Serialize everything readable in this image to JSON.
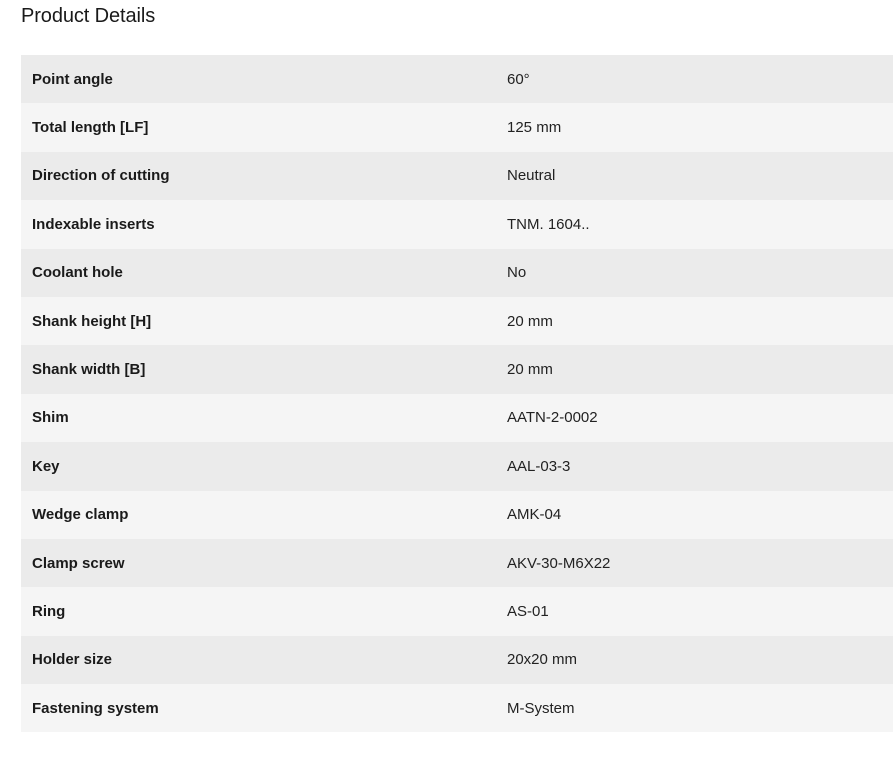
{
  "page": {
    "title": "Product Details"
  },
  "details": [
    {
      "label": "Point angle",
      "value": "60°"
    },
    {
      "label": "Total length [LF]",
      "value": "125 mm"
    },
    {
      "label": "Direction of cutting",
      "value": "Neutral"
    },
    {
      "label": "Indexable inserts",
      "value": "TNM. 1604.."
    },
    {
      "label": "Coolant hole",
      "value": "No"
    },
    {
      "label": "Shank height [H]",
      "value": "20 mm"
    },
    {
      "label": "Shank width [B]",
      "value": "20 mm"
    },
    {
      "label": "Shim",
      "value": "AATN-2-0002"
    },
    {
      "label": "Key",
      "value": "AAL-03-3"
    },
    {
      "label": "Wedge clamp",
      "value": "AMK-04"
    },
    {
      "label": "Clamp screw",
      "value": "AKV-30-M6X22"
    },
    {
      "label": "Ring",
      "value": "AS-01"
    },
    {
      "label": "Holder size",
      "value": "20x20 mm"
    },
    {
      "label": "Fastening system",
      "value": "M-System"
    }
  ]
}
